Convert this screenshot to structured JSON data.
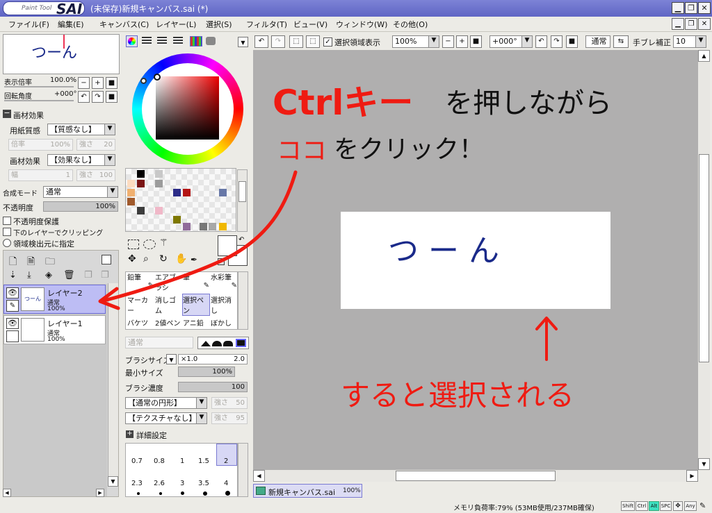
{
  "title_bar": {
    "logo_small": "Paint Tool",
    "logo_big": "SAI",
    "document_title": "(未保存)新規キャンバス.sai (*)",
    "window_buttons": [
      "minimize",
      "restore",
      "close"
    ]
  },
  "menu": [
    "ファイル(F)",
    "編集(E)",
    "キャンバス(C)",
    "レイヤー(L)",
    "選択(S)",
    "フィルタ(T)",
    "ビュー(V)",
    "ウィンドウ(W)",
    "その他(O)"
  ],
  "navigator": {
    "thumb_text": "つーん",
    "zoom_label": "表示倍率",
    "zoom_value": "100.0%",
    "rotate_label": "回転角度",
    "rotate_value": "+000°"
  },
  "paper": {
    "section": "画材効果",
    "texture_label": "用紙質感",
    "texture_value": "【質感なし】",
    "scale_label": "倍率",
    "scale_value": "100%",
    "strength_label": "強さ",
    "strength_value": "20",
    "effect_label": "画材効果",
    "effect_value": "【効果なし】",
    "width_label": "幅",
    "width_value": "1",
    "strength2_label": "強さ",
    "strength2_value": "100"
  },
  "layer_props": {
    "blend_label": "合成モード",
    "blend_value": "通常",
    "opacity_label": "不透明度",
    "opacity_value": "100%",
    "protect": "不透明度保護",
    "clip": "下のレイヤーでクリッピング",
    "detect": "領域検出元に指定"
  },
  "layers": [
    {
      "name": "レイヤー2",
      "mode": "通常",
      "opacity": "100%",
      "thumb_text": "つーん",
      "selected": true
    },
    {
      "name": "レイヤー1",
      "mode": "通常",
      "opacity": "100%",
      "thumb_text": "",
      "selected": false
    }
  ],
  "swatch_colors": [
    "#000000",
    "#ffffff",
    "#c8c8c8",
    "#fcdcc0",
    "#7a1414",
    "#9c9c9c",
    "#f0b070",
    "#a05a2c",
    "#2c2c88",
    "#b41414",
    "#6878a8",
    "#d6925a",
    "#3c3c3c",
    "#f0b8c8",
    "#7e7800",
    "#906a9a",
    "#787878",
    "#a8a8a8",
    "#f0b800"
  ],
  "tools": [
    [
      "鉛筆",
      "エアブラシ",
      "筆",
      "水彩筆"
    ],
    [
      "マーカー",
      "消しゴム",
      "選択ペン",
      "選択消し"
    ],
    [
      "バケツ",
      "2値ペン",
      "アニ鉛画",
      "ぼかし"
    ]
  ],
  "brush": {
    "mode_value": "通常",
    "size_label": "ブラシサイズ",
    "size_mult": "×1.0",
    "size_value": "2.0",
    "min_label": "最小サイズ",
    "min_value": "100%",
    "density_label": "ブラシ濃度",
    "density_value": "100",
    "shape_value": "【通常の円形】",
    "shape_strength_label": "強さ",
    "shape_strength_value": "50",
    "texture_value": "【テクスチャなし】",
    "texture_strength_label": "強さ",
    "texture_strength_value": "95",
    "detail_label": "詳細設定"
  },
  "brush_sizes": [
    "0.7",
    "0.8",
    "1",
    "1.5",
    "2",
    "2.3",
    "2.6",
    "3",
    "3.5",
    "4"
  ],
  "canvas_toolbar": {
    "selection_label": "選択領域表示",
    "zoom_value": "100%",
    "rotate_value": "+000°",
    "mode_value": "通常",
    "stabilizer_label": "手ブレ補正",
    "stabilizer_value": "10"
  },
  "annotations": {
    "line1a": "Ctrlキー",
    "line1b": "を押しながら",
    "line2a": "ココ",
    "line2b": "をクリック！",
    "canvas_text": "つーん",
    "bottom": "すると選択される"
  },
  "doc_tab": {
    "name": "新規キャンバス.sai",
    "zoom": "100%"
  },
  "status": {
    "memory": "メモリ負荷率:79% (53MB使用/237MB確保)",
    "keys": [
      "Shift",
      "Ctrl",
      "Alt",
      "SPC",
      "Any"
    ]
  }
}
